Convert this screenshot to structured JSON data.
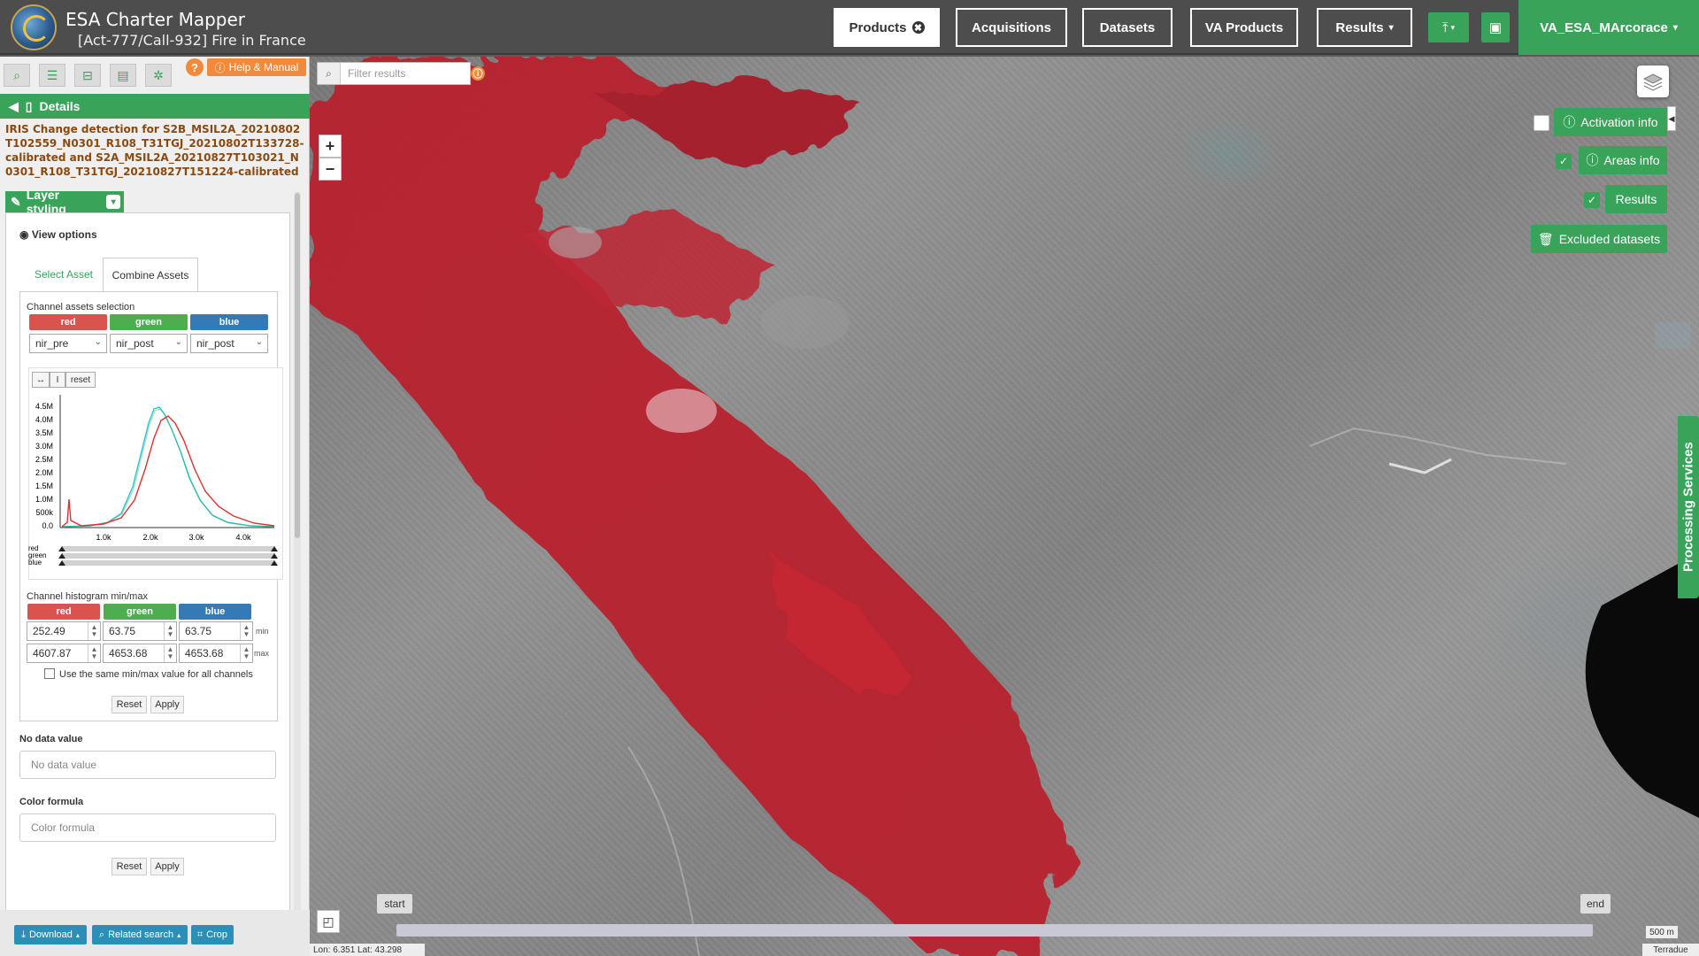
{
  "header": {
    "app_title": "ESA Charter Mapper",
    "subtitle": "[Act-777/Call-932] Fire in France",
    "nav": [
      {
        "label": "Products",
        "active": true,
        "extra": "✖"
      },
      {
        "label": "Acquisitions",
        "active": false
      },
      {
        "label": "Datasets",
        "active": false
      },
      {
        "label": "VA Products",
        "active": false
      },
      {
        "label": "Results",
        "active": false,
        "extra": "▾"
      }
    ],
    "upload_icon": "upload-icon",
    "briefcase_icon": "briefcase-icon",
    "user": "VA_ESA_MArcorace"
  },
  "left_panel": {
    "tools": [
      "search-icon",
      "list-icon",
      "basket-icon",
      "inbox-icon",
      "gear-icon"
    ],
    "help_label": "Help & Manual",
    "help_q": "?",
    "details_label": "Details",
    "product_title": "IRIS Change detection for S2B_MSIL2A_20210802T102559_N0301_R108_T31TGJ_20210802T133728-calibrated and S2A_MSIL2A_20210827T103021_N0301_R108_T31TGJ_20210827T151224-calibrated",
    "layer_styling_label": "Layer styling",
    "view_options_label": "View options",
    "tabs": {
      "select_asset": "Select Asset",
      "combine_assets": "Combine Assets"
    },
    "channel_selection_label": "Channel assets selection",
    "channels": {
      "red": "red",
      "green": "green",
      "blue": "blue"
    },
    "channel_values": {
      "red": "nir_pre",
      "green": "nir_post",
      "blue": "nir_post"
    },
    "histogram": {
      "reset_label": "reset",
      "y_ticks": [
        "4.5M",
        "4.0M",
        "3.5M",
        "3.0M",
        "2.5M",
        "2.0M",
        "1.5M",
        "1.0M",
        "500k",
        "0.0"
      ],
      "x_ticks": [
        "1.0k",
        "2.0k",
        "3.0k",
        "4.0k"
      ],
      "slider_labels": [
        "red",
        "green",
        "blue"
      ]
    },
    "minmax_label": "Channel histogram min/max",
    "min": {
      "red": "252.49",
      "green": "63.75",
      "blue": "63.75"
    },
    "max": {
      "red": "4607.87",
      "green": "4653.68",
      "blue": "4653.68"
    },
    "min_label": "min",
    "max_label": "max",
    "same_minmax_label": "Use the same min/max value for all channels",
    "reset_label": "Reset",
    "apply_label": "Apply",
    "no_data_label": "No data value",
    "no_data_placeholder": "No data value",
    "color_formula_label": "Color formula",
    "color_formula_placeholder": "Color formula",
    "bottom": {
      "download": "Download",
      "related": "Related search",
      "crop": "Crop"
    }
  },
  "map": {
    "filter_placeholder": "Filter results",
    "zoom_in": "+",
    "zoom_out": "−",
    "activation_info": "Activation info",
    "areas_info": "Areas info",
    "results": "Results",
    "excluded_datasets": "Excluded datasets",
    "processing_services": "Processing Services",
    "timeline_start": "start",
    "timeline_end": "end",
    "coords": "Lon: 6.351  Lat: 43.298",
    "scale": "500 m",
    "attribution": "Terradue"
  },
  "colors": {
    "accent": "#3aa35a",
    "red_channel": "#d9534f",
    "green_channel": "#4cae4c",
    "blue_channel": "#337ab7",
    "orange": "#f08a3c"
  }
}
